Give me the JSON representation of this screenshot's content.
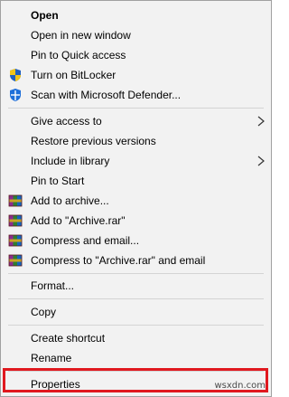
{
  "menu": {
    "items": [
      {
        "label": "Open",
        "bold": true,
        "icon": "none"
      },
      {
        "label": "Open in new window",
        "icon": "none"
      },
      {
        "label": "Pin to Quick access",
        "icon": "none"
      },
      {
        "label": "Turn on BitLocker",
        "icon": "shield-icon"
      },
      {
        "label": "Scan with Microsoft Defender...",
        "icon": "defender-icon"
      },
      {
        "label": "Give access to",
        "icon": "none",
        "submenu": true
      },
      {
        "label": "Restore previous versions",
        "icon": "none"
      },
      {
        "label": "Include in library",
        "icon": "none",
        "submenu": true
      },
      {
        "label": "Pin to Start",
        "icon": "none"
      },
      {
        "label": "Add to archive...",
        "icon": "winrar-icon"
      },
      {
        "label": "Add to \"Archive.rar\"",
        "icon": "winrar-icon"
      },
      {
        "label": "Compress and email...",
        "icon": "winrar-icon"
      },
      {
        "label": "Compress to \"Archive.rar\" and email",
        "icon": "winrar-icon"
      },
      {
        "label": "Format...",
        "icon": "none"
      },
      {
        "label": "Copy",
        "icon": "none"
      },
      {
        "label": "Create shortcut",
        "icon": "none"
      },
      {
        "label": "Rename",
        "icon": "none"
      },
      {
        "label": "Properties",
        "icon": "none",
        "highlighted": true
      }
    ]
  },
  "colors": {
    "menu_background": "#f2f2f2",
    "highlight_border": "#e0191f",
    "separator": "#d4d4d4"
  },
  "watermark": "wsxdn.com"
}
